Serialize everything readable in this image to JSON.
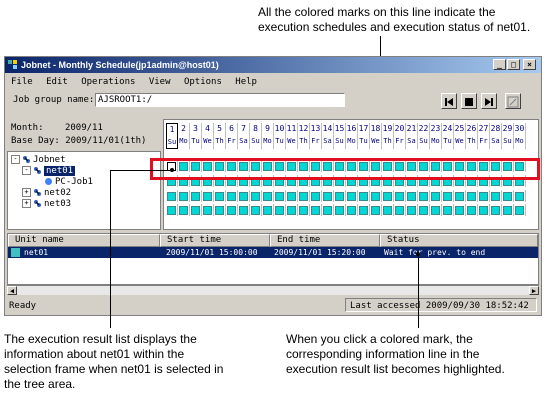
{
  "callouts": {
    "top": [
      "All the colored marks on this line indicate the",
      "execution schedules and execution status of net01."
    ],
    "bottom_left": [
      "The execution result list displays the",
      "information about net01 within the",
      "selection frame when net01 is selected in",
      "the tree area."
    ],
    "bottom_right": [
      "When you click a colored mark, the",
      "corresponding information line in the",
      "execution result list becomes highlighted."
    ]
  },
  "window": {
    "title": "Jobnet - Monthly Schedule(jp1admin@host01)",
    "controls": [
      "_",
      "□",
      "×"
    ],
    "menu": [
      "File",
      "Edit",
      "Operations",
      "View",
      "Options",
      "Help"
    ],
    "job_group_label": "Job group name:",
    "job_group_value": "AJSROOT1:/",
    "toolbar_icons": [
      "prev-icon",
      "stop-icon",
      "next-icon",
      "settings-icon"
    ]
  },
  "info": {
    "month_label": "Month:",
    "month_value": "2009/11",
    "base_day_label": "Base Day:",
    "base_day_value": "2009/11/01(1th)"
  },
  "tree": [
    {
      "label": "Jobnet",
      "expander": "-"
    },
    {
      "label": "net01",
      "expander": "-",
      "selected": true
    },
    {
      "label": "PC-Job1"
    },
    {
      "label": "net02",
      "expander": "+"
    },
    {
      "label": "net03",
      "expander": "+"
    }
  ],
  "calendar": {
    "days": [
      "1",
      "2",
      "3",
      "4",
      "5",
      "6",
      "7",
      "8",
      "9",
      "10",
      "11",
      "12",
      "13",
      "14",
      "15",
      "16",
      "17",
      "18",
      "19",
      "20",
      "21",
      "22",
      "23",
      "24",
      "25",
      "26",
      "27",
      "28",
      "29",
      "30"
    ],
    "weekdays": [
      "Su",
      "Mo",
      "Tu",
      "We",
      "Th",
      "Fr",
      "Sa",
      "Su",
      "Mo",
      "Tu",
      "We",
      "Th",
      "Fr",
      "Sa",
      "Su",
      "Mo",
      "Tu",
      "We",
      "Th",
      "Fr",
      "Sa",
      "Su",
      "Mo",
      "Tu",
      "We",
      "Th",
      "Fr",
      "Sa",
      "Su",
      "Mo"
    ],
    "mark_color": "#00d8d8"
  },
  "result_list": {
    "headers": [
      "Unit name",
      "Start time",
      "End time",
      "Status"
    ],
    "rows": [
      {
        "unit": "net01",
        "start": "2009/11/01 15:00:00",
        "end": "2009/11/01 15:20:00",
        "status": "Wait for prev. to end"
      }
    ]
  },
  "statusbar": {
    "left": "Ready",
    "right": "Last accessed 2009/09/30 18:52:42"
  },
  "highlight_color": "#e01020"
}
